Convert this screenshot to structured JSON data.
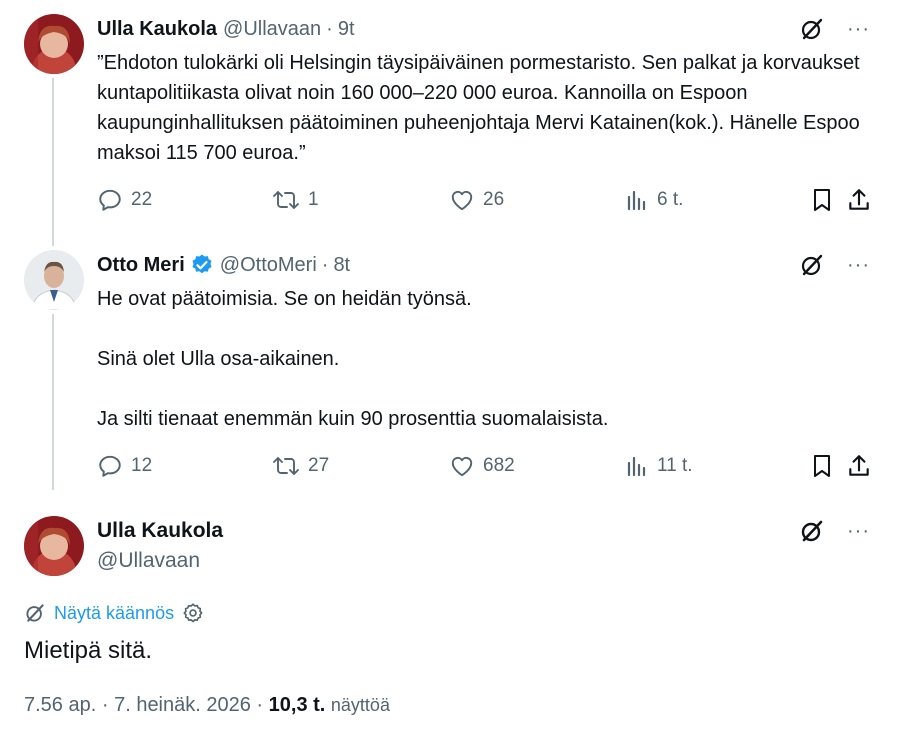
{
  "tweets": [
    {
      "name": "Ulla Kaukola",
      "handle": "@Ullavaan",
      "time": "9t",
      "paragraphs": [
        "”Ehdoton tulokärki oli Helsingin täysipäiväinen pormestaristo. Sen palkat ja korvaukset kuntapolitiikasta olivat noin 160 000–220 000 euroa. Kannoilla on Espoon kaupunginhallituksen päätoiminen puheenjohtaja Mervi Katainen(kok.). Hänelle Espoo maksoi 115 700 euroa.”"
      ],
      "replies": "22",
      "retweets": "1",
      "likes": "26",
      "views": "6 t."
    },
    {
      "name": "Otto Meri",
      "handle": "@OttoMeri",
      "time": "8t",
      "verified": true,
      "paragraphs": [
        "He ovat päätoimisia. Se on heidän työnsä.",
        "Sinä olet Ulla osa-aikainen.",
        "Ja silti tienaat enemmän kuin 90 prosenttia suomalaisista."
      ],
      "replies": "12",
      "retweets": "27",
      "likes": "682",
      "views": "11 t."
    }
  ],
  "main_tweet": {
    "name": "Ulla Kaukola",
    "handle": "@Ullavaan",
    "translate_label": "Näytä käännös",
    "text": "Mietipä sitä.",
    "time": "7.56 ap.",
    "date": "7. heinäk. 2026",
    "views_count": "10,3 t.",
    "views_label": "näyttöä"
  },
  "more_label": "···",
  "colors": {
    "accent": "#1d9bf0",
    "secondary_text": "#536471",
    "primary_text": "#0f1419",
    "thread_line": "#cfd9de"
  }
}
